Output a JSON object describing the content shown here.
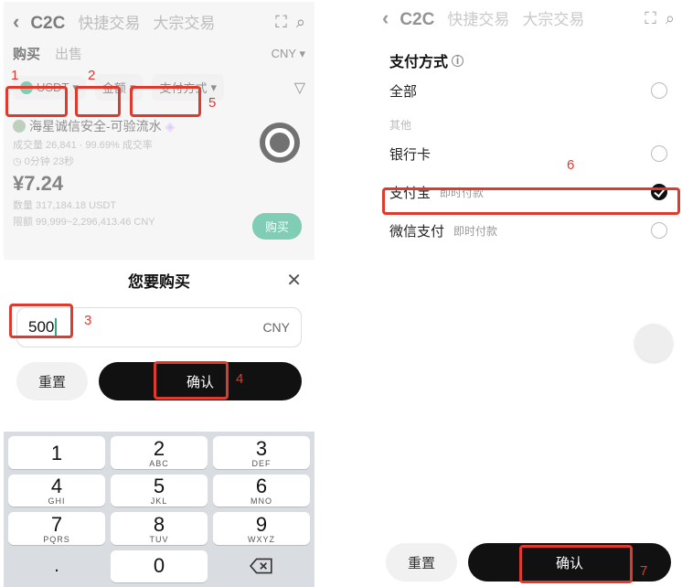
{
  "left": {
    "nav": {
      "back": "‹",
      "tabs": [
        "C2C",
        "快捷交易",
        "大宗交易"
      ],
      "active": 0
    },
    "subtabs": {
      "buy": "购买",
      "sell": "出售",
      "cny": "CNY ▾"
    },
    "filters": {
      "coin": "USDT",
      "amount": "金额",
      "payment": "支付方式"
    },
    "merchant": {
      "name": "海星诚信安全-可验流水",
      "stats": "成交量 26,841 · 99.69% 成交率",
      "delay": "◷ 0分钟 23秒",
      "price": "¥7.24",
      "per": "数量 317,184.18 USDT",
      "range": "限额 99,999~2,296,413.46 CNY",
      "buy": "购买"
    },
    "sheet": {
      "title": "您要购买",
      "amount": "500",
      "unit": "CNY",
      "reset": "重置",
      "confirm": "确认"
    },
    "keypad": {
      "1": {
        "n": "1",
        "s": ""
      },
      "2": {
        "n": "2",
        "s": "ABC"
      },
      "3": {
        "n": "3",
        "s": "DEF"
      },
      "4": {
        "n": "4",
        "s": "GHI"
      },
      "5": {
        "n": "5",
        "s": "JKL"
      },
      "6": {
        "n": "6",
        "s": "MNO"
      },
      "7": {
        "n": "7",
        "s": "PQRS"
      },
      "8": {
        "n": "8",
        "s": "TUV"
      },
      "9": {
        "n": "9",
        "s": "WXYZ"
      },
      "dot": ".",
      "0": {
        "n": "0",
        "s": ""
      }
    }
  },
  "right": {
    "nav": {
      "back": "‹",
      "tabs": [
        "C2C",
        "快捷交易",
        "大宗交易"
      ]
    },
    "title": "支付方式",
    "all": "全部",
    "section": "其他",
    "bank": "银行卡",
    "alipay": "支付宝",
    "alipay_sub": "即时付款",
    "wechat": "微信支付",
    "wechat_sub": "即时付款",
    "reset": "重置",
    "confirm": "确认"
  },
  "ann": {
    "1": "1",
    "2": "2",
    "3": "3",
    "4": "4",
    "5": "5",
    "6": "6",
    "7": "7"
  }
}
